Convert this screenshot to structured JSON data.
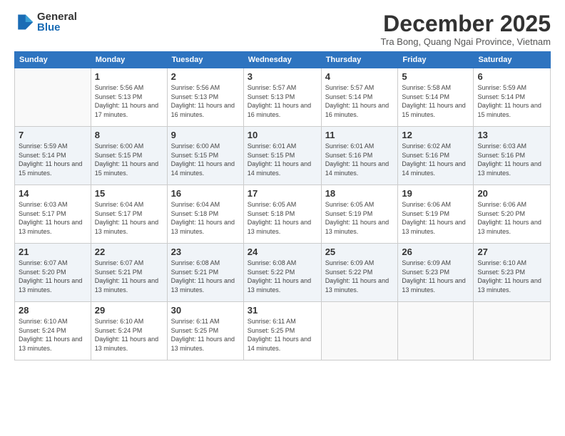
{
  "logo": {
    "general": "General",
    "blue": "Blue"
  },
  "title": "December 2025",
  "location": "Tra Bong, Quang Ngai Province, Vietnam",
  "headers": [
    "Sunday",
    "Monday",
    "Tuesday",
    "Wednesday",
    "Thursday",
    "Friday",
    "Saturday"
  ],
  "weeks": [
    [
      {
        "day": "",
        "sunrise": "",
        "sunset": "",
        "daylight": ""
      },
      {
        "day": "1",
        "sunrise": "Sunrise: 5:56 AM",
        "sunset": "Sunset: 5:13 PM",
        "daylight": "Daylight: 11 hours and 17 minutes."
      },
      {
        "day": "2",
        "sunrise": "Sunrise: 5:56 AM",
        "sunset": "Sunset: 5:13 PM",
        "daylight": "Daylight: 11 hours and 16 minutes."
      },
      {
        "day": "3",
        "sunrise": "Sunrise: 5:57 AM",
        "sunset": "Sunset: 5:13 PM",
        "daylight": "Daylight: 11 hours and 16 minutes."
      },
      {
        "day": "4",
        "sunrise": "Sunrise: 5:57 AM",
        "sunset": "Sunset: 5:14 PM",
        "daylight": "Daylight: 11 hours and 16 minutes."
      },
      {
        "day": "5",
        "sunrise": "Sunrise: 5:58 AM",
        "sunset": "Sunset: 5:14 PM",
        "daylight": "Daylight: 11 hours and 15 minutes."
      },
      {
        "day": "6",
        "sunrise": "Sunrise: 5:59 AM",
        "sunset": "Sunset: 5:14 PM",
        "daylight": "Daylight: 11 hours and 15 minutes."
      }
    ],
    [
      {
        "day": "7",
        "sunrise": "Sunrise: 5:59 AM",
        "sunset": "Sunset: 5:14 PM",
        "daylight": "Daylight: 11 hours and 15 minutes."
      },
      {
        "day": "8",
        "sunrise": "Sunrise: 6:00 AM",
        "sunset": "Sunset: 5:15 PM",
        "daylight": "Daylight: 11 hours and 15 minutes."
      },
      {
        "day": "9",
        "sunrise": "Sunrise: 6:00 AM",
        "sunset": "Sunset: 5:15 PM",
        "daylight": "Daylight: 11 hours and 14 minutes."
      },
      {
        "day": "10",
        "sunrise": "Sunrise: 6:01 AM",
        "sunset": "Sunset: 5:15 PM",
        "daylight": "Daylight: 11 hours and 14 minutes."
      },
      {
        "day": "11",
        "sunrise": "Sunrise: 6:01 AM",
        "sunset": "Sunset: 5:16 PM",
        "daylight": "Daylight: 11 hours and 14 minutes."
      },
      {
        "day": "12",
        "sunrise": "Sunrise: 6:02 AM",
        "sunset": "Sunset: 5:16 PM",
        "daylight": "Daylight: 11 hours and 14 minutes."
      },
      {
        "day": "13",
        "sunrise": "Sunrise: 6:03 AM",
        "sunset": "Sunset: 5:16 PM",
        "daylight": "Daylight: 11 hours and 13 minutes."
      }
    ],
    [
      {
        "day": "14",
        "sunrise": "Sunrise: 6:03 AM",
        "sunset": "Sunset: 5:17 PM",
        "daylight": "Daylight: 11 hours and 13 minutes."
      },
      {
        "day": "15",
        "sunrise": "Sunrise: 6:04 AM",
        "sunset": "Sunset: 5:17 PM",
        "daylight": "Daylight: 11 hours and 13 minutes."
      },
      {
        "day": "16",
        "sunrise": "Sunrise: 6:04 AM",
        "sunset": "Sunset: 5:18 PM",
        "daylight": "Daylight: 11 hours and 13 minutes."
      },
      {
        "day": "17",
        "sunrise": "Sunrise: 6:05 AM",
        "sunset": "Sunset: 5:18 PM",
        "daylight": "Daylight: 11 hours and 13 minutes."
      },
      {
        "day": "18",
        "sunrise": "Sunrise: 6:05 AM",
        "sunset": "Sunset: 5:19 PM",
        "daylight": "Daylight: 11 hours and 13 minutes."
      },
      {
        "day": "19",
        "sunrise": "Sunrise: 6:06 AM",
        "sunset": "Sunset: 5:19 PM",
        "daylight": "Daylight: 11 hours and 13 minutes."
      },
      {
        "day": "20",
        "sunrise": "Sunrise: 6:06 AM",
        "sunset": "Sunset: 5:20 PM",
        "daylight": "Daylight: 11 hours and 13 minutes."
      }
    ],
    [
      {
        "day": "21",
        "sunrise": "Sunrise: 6:07 AM",
        "sunset": "Sunset: 5:20 PM",
        "daylight": "Daylight: 11 hours and 13 minutes."
      },
      {
        "day": "22",
        "sunrise": "Sunrise: 6:07 AM",
        "sunset": "Sunset: 5:21 PM",
        "daylight": "Daylight: 11 hours and 13 minutes."
      },
      {
        "day": "23",
        "sunrise": "Sunrise: 6:08 AM",
        "sunset": "Sunset: 5:21 PM",
        "daylight": "Daylight: 11 hours and 13 minutes."
      },
      {
        "day": "24",
        "sunrise": "Sunrise: 6:08 AM",
        "sunset": "Sunset: 5:22 PM",
        "daylight": "Daylight: 11 hours and 13 minutes."
      },
      {
        "day": "25",
        "sunrise": "Sunrise: 6:09 AM",
        "sunset": "Sunset: 5:22 PM",
        "daylight": "Daylight: 11 hours and 13 minutes."
      },
      {
        "day": "26",
        "sunrise": "Sunrise: 6:09 AM",
        "sunset": "Sunset: 5:23 PM",
        "daylight": "Daylight: 11 hours and 13 minutes."
      },
      {
        "day": "27",
        "sunrise": "Sunrise: 6:10 AM",
        "sunset": "Sunset: 5:23 PM",
        "daylight": "Daylight: 11 hours and 13 minutes."
      }
    ],
    [
      {
        "day": "28",
        "sunrise": "Sunrise: 6:10 AM",
        "sunset": "Sunset: 5:24 PM",
        "daylight": "Daylight: 11 hours and 13 minutes."
      },
      {
        "day": "29",
        "sunrise": "Sunrise: 6:10 AM",
        "sunset": "Sunset: 5:24 PM",
        "daylight": "Daylight: 11 hours and 13 minutes."
      },
      {
        "day": "30",
        "sunrise": "Sunrise: 6:11 AM",
        "sunset": "Sunset: 5:25 PM",
        "daylight": "Daylight: 11 hours and 13 minutes."
      },
      {
        "day": "31",
        "sunrise": "Sunrise: 6:11 AM",
        "sunset": "Sunset: 5:25 PM",
        "daylight": "Daylight: 11 hours and 14 minutes."
      },
      {
        "day": "",
        "sunrise": "",
        "sunset": "",
        "daylight": ""
      },
      {
        "day": "",
        "sunrise": "",
        "sunset": "",
        "daylight": ""
      },
      {
        "day": "",
        "sunrise": "",
        "sunset": "",
        "daylight": ""
      }
    ]
  ]
}
